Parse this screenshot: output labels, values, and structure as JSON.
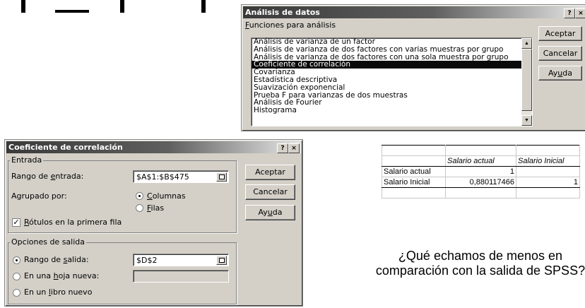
{
  "analysis_dialog": {
    "title": "Análisis de datos",
    "help_button": "?",
    "close_button": "×",
    "functions_label": "Funciones para análisis",
    "functions": [
      "Análisis de varianza de un factor",
      "Análisis de varianza de dos factores con varias muestras por grupo",
      "Análisis de varianza de dos factores con una sola muestra por grupo",
      "Coeficiente de correlación",
      "Covarianza",
      "Estadística descriptiva",
      "Suavización exponencial",
      "Prueba F para varianzas de dos muestras",
      "Análisis de Fourier",
      "Histograma"
    ],
    "selected_function": "Coeficiente de correlación",
    "ok_label": "Aceptar",
    "cancel_label": "Cancelar",
    "help_label": "Ayuda"
  },
  "correlation_dialog": {
    "title": "Coeficiente de correlación",
    "help_button": "?",
    "close_button": "×",
    "input_group": "Entrada",
    "input_range_label": "Rango de entrada:",
    "input_range_value": "$A$1:$B$475",
    "grouped_by_label": "Agrupado por:",
    "columns_label": "Columnas",
    "rows_label": "Filas",
    "labels_first_row": "Rótulos en la primera fila",
    "output_group": "Opciones de salida",
    "output_range_label": "Rango de salida:",
    "output_range_value": "$D$2",
    "new_sheet_label": "En una hoja nueva:",
    "new_book_label": "En un libro nuevo",
    "ok_label": "Aceptar",
    "cancel_label": "Cancelar",
    "help_label": "Ayuda"
  },
  "result_table": {
    "headers": [
      "",
      "Salario actual",
      "Salario Inicial"
    ],
    "rows": [
      [
        "Salario actual",
        "1",
        ""
      ],
      [
        "Salario Inicial",
        "0,880117466",
        "1"
      ]
    ]
  },
  "question": "¿Qué echamos de menos en comparación con la salida de SPSS?"
}
